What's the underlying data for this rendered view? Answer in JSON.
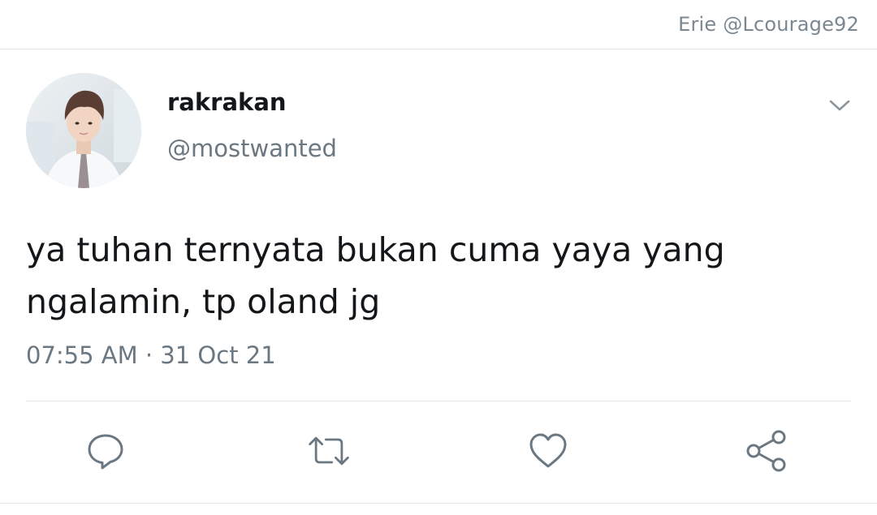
{
  "header": {
    "context_label": "Erie @Lcourage92"
  },
  "tweet": {
    "display_name": "rakrakan",
    "handle": "@mostwanted",
    "text": "ya tuhan ternyata bukan cuma yaya yang ngalamin, tp oland jg",
    "timestamp": "07:55 AM · 31 Oct 21"
  },
  "actions": {
    "icons": [
      "reply-icon",
      "retweet-icon",
      "like-icon",
      "share-icon"
    ]
  },
  "colors": {
    "icon": "#6b7781",
    "text_primary": "#14171a",
    "text_secondary": "#6b7781",
    "divider": "#dfe3e7"
  }
}
